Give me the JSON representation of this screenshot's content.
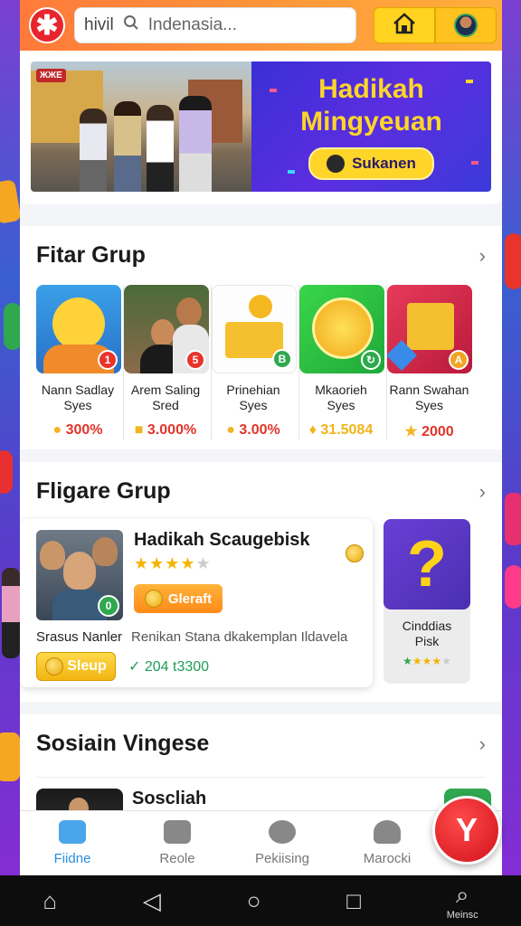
{
  "header": {
    "search_prefix": "hivil",
    "search_placeholder": "Indenasia...",
    "home_icon": "home-icon",
    "profile_icon": "avatar"
  },
  "banner": {
    "photo_sign": "ЖЖЕ",
    "title_line1": "Hadikah",
    "title_line2": "Mingyeuan",
    "cta_label": "Sukanen"
  },
  "section1": {
    "title": "Fitar Grup",
    "cards": [
      {
        "name_line1": "Nann Sadlay",
        "name_line2": "Syes",
        "value": "300%",
        "badge": "1",
        "badge_color": "#e8342a"
      },
      {
        "name_line1": "Arem Saling",
        "name_line2": "Sred",
        "value": "3.000%",
        "badge": "5",
        "badge_color": "#e8342a"
      },
      {
        "name_line1": "Prinehian",
        "name_line2": "Syes",
        "value": "3.00%",
        "badge": "B",
        "badge_color": "#2fa84f"
      },
      {
        "name_line1": "Mkaorieh",
        "name_line2": "Syes",
        "value": "31.5084",
        "badge": "↻",
        "badge_color": "#2fa84f"
      },
      {
        "name_line1": "Rann Swahan",
        "name_line2": "Syes",
        "value": "2000",
        "badge": "A",
        "badge_color": "#f1a420"
      }
    ]
  },
  "section2": {
    "title": "Fligare Grup",
    "featured": {
      "title": "Hadikah Scaugebisk",
      "rating": 4,
      "button_label": "Gleraft",
      "author": "Srasus Nanler",
      "description": "Renikan Stana dkakemplan Ildavela",
      "join_label": "Sleup",
      "price": "204 t3300",
      "badge": "0"
    },
    "side_card": {
      "symbol": "?",
      "name_line1": "Cinddias",
      "name_line2": "Pisk"
    }
  },
  "section3": {
    "title": "Sosiain Vingese",
    "item_title": "Soscliah"
  },
  "bottom_nav": [
    {
      "label": "Fiidne",
      "icon": "home-icon",
      "active": true
    },
    {
      "label": "Reole",
      "icon": "thumbs-up-icon",
      "active": false
    },
    {
      "label": "Pekiising",
      "icon": "chat-icon",
      "active": false
    },
    {
      "label": "Marocki",
      "icon": "profile-icon",
      "active": false
    }
  ],
  "fab_label": "Y",
  "system_nav": {
    "search_label": "Meinsc"
  }
}
